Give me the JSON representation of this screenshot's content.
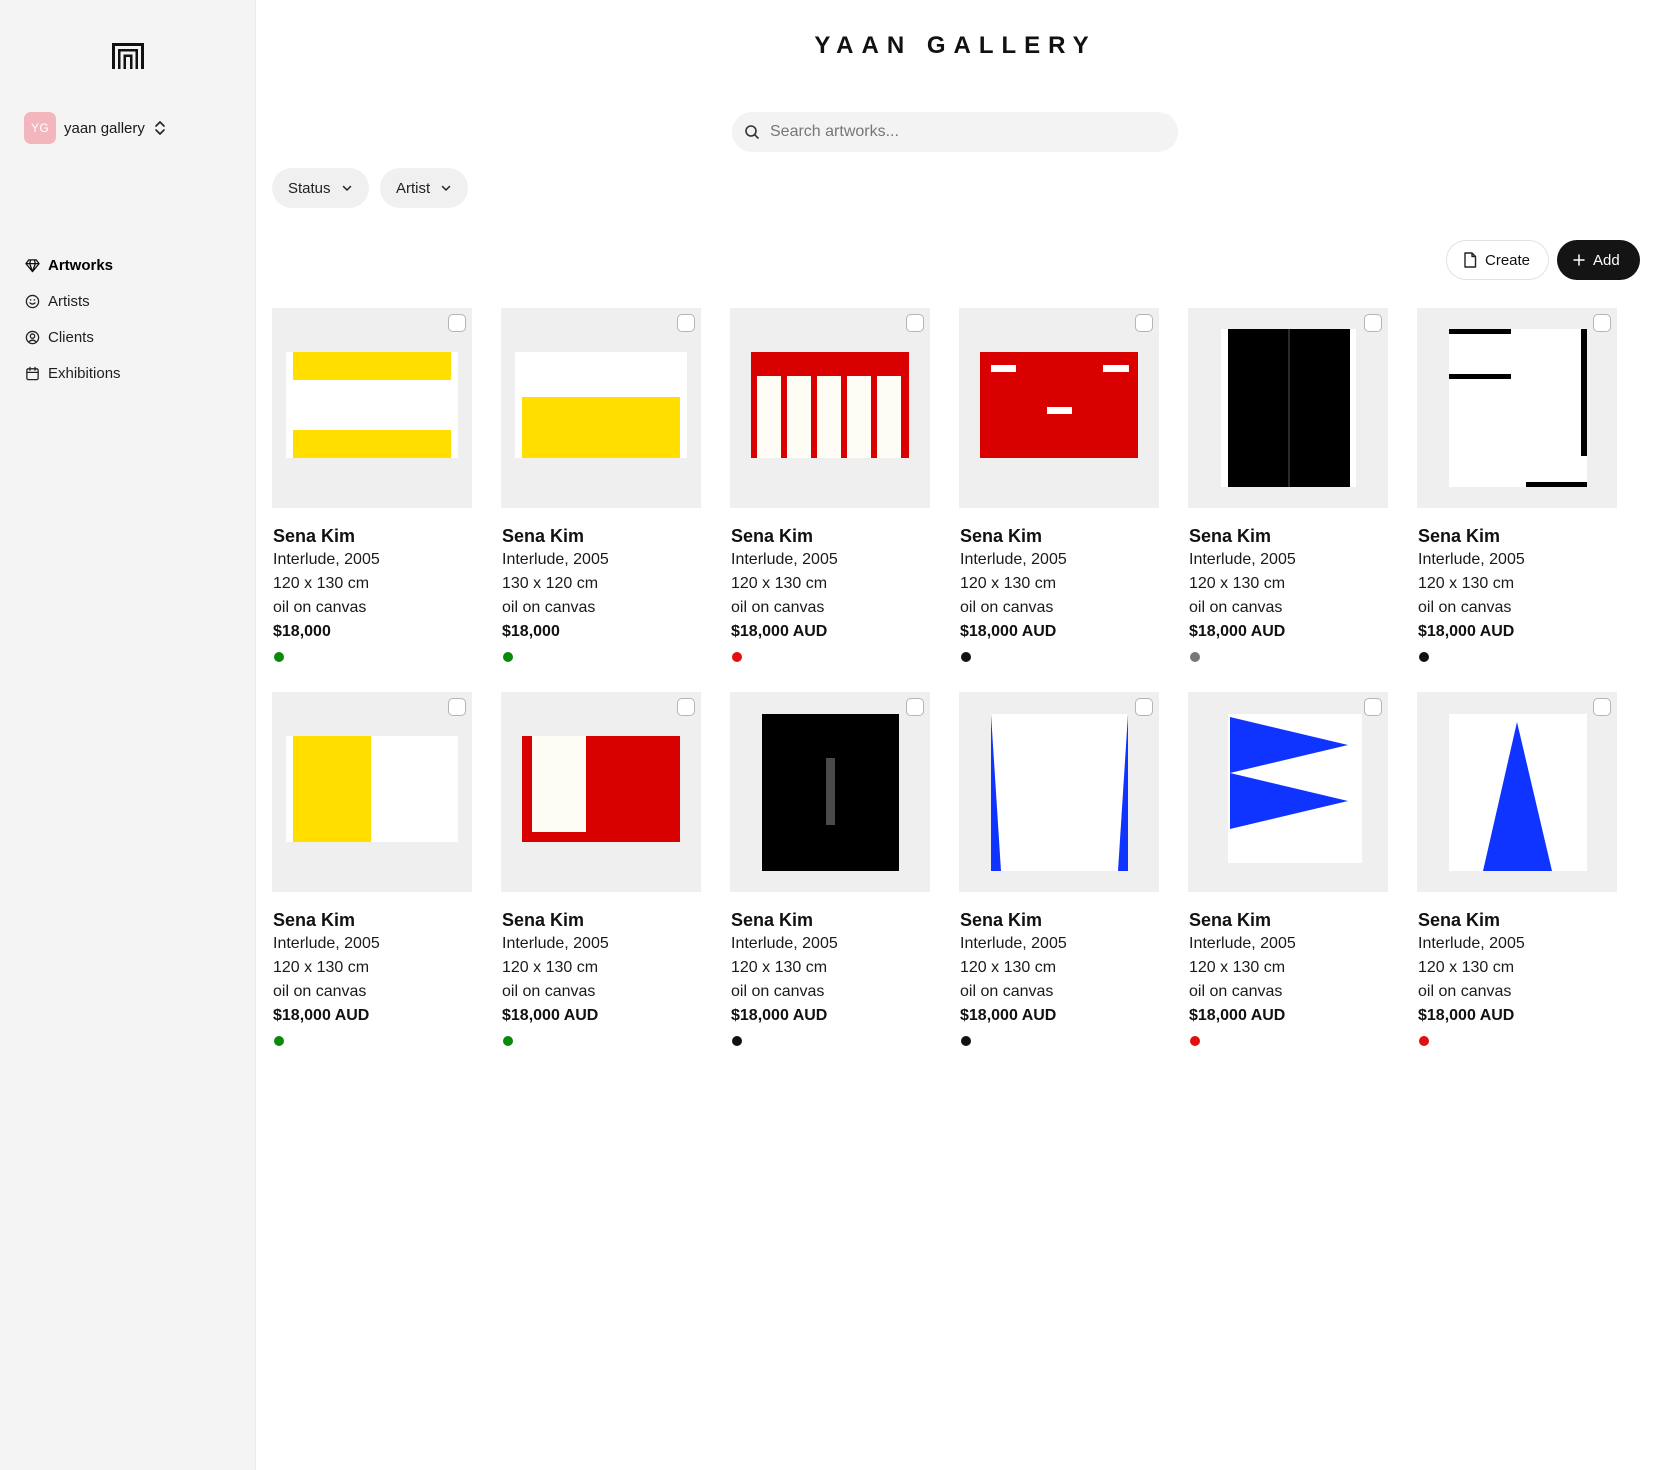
{
  "sidebar": {
    "org": {
      "initials": "YG",
      "name": "yaan gallery"
    },
    "nav": [
      {
        "label": "Artworks",
        "icon": "gem-icon",
        "active": true
      },
      {
        "label": "Artists",
        "icon": "smile-icon",
        "active": false
      },
      {
        "label": "Clients",
        "icon": "user-circle-icon",
        "active": false
      },
      {
        "label": "Exhibitions",
        "icon": "calendar-icon",
        "active": false
      }
    ]
  },
  "header": {
    "title": "YAAN GALLERY"
  },
  "search": {
    "placeholder": "Search artworks..."
  },
  "filters": [
    {
      "label": "Status"
    },
    {
      "label": "Artist"
    }
  ],
  "actions": {
    "create_label": "Create",
    "add_label": "Add"
  },
  "status_colors": {
    "green": "#0a8a0a",
    "red": "#e01010",
    "black": "#111111",
    "gray": "#777777"
  },
  "artworks": [
    {
      "artist": "Sena Kim",
      "title": "Interlude, 2005",
      "size": "120 x 130 cm",
      "medium": "oil on canvas",
      "price": "$18,000",
      "status": "green",
      "art": "yellow-stripes"
    },
    {
      "artist": "Sena Kim",
      "title": "Interlude, 2005",
      "size": "130 x 120 cm",
      "medium": "oil on canvas",
      "price": "$18,000",
      "status": "green",
      "art": "yellow-bottom"
    },
    {
      "artist": "Sena Kim",
      "title": "Interlude, 2005",
      "size": "120 x 130 cm",
      "medium": "oil on canvas",
      "price": "$18,000 AUD",
      "status": "red",
      "art": "red-bars"
    },
    {
      "artist": "Sena Kim",
      "title": "Interlude, 2005",
      "size": "120 x 130 cm",
      "medium": "oil on canvas",
      "price": "$18,000 AUD",
      "status": "black",
      "art": "red-dashes"
    },
    {
      "artist": "Sena Kim",
      "title": "Interlude, 2005",
      "size": "120 x 130 cm",
      "medium": "oil on canvas",
      "price": "$18,000 AUD",
      "status": "gray",
      "art": "black-diptych"
    },
    {
      "artist": "Sena Kim",
      "title": "Interlude, 2005",
      "size": "120 x 130 cm",
      "medium": "oil on canvas",
      "price": "$18,000 AUD",
      "status": "black",
      "art": "black-lines"
    },
    {
      "artist": "Sena Kim",
      "title": "Interlude, 2005",
      "size": "120 x 130 cm",
      "medium": "oil on canvas",
      "price": "$18,000 AUD",
      "status": "green",
      "art": "yellow-left"
    },
    {
      "artist": "Sena Kim",
      "title": "Interlude, 2005",
      "size": "120 x 130 cm",
      "medium": "oil on canvas",
      "price": "$18,000 AUD",
      "status": "green",
      "art": "red-white-block"
    },
    {
      "artist": "Sena Kim",
      "title": "Interlude, 2005",
      "size": "120 x 130 cm",
      "medium": "oil on canvas",
      "price": "$18,000 AUD",
      "status": "black",
      "art": "black-square"
    },
    {
      "artist": "Sena Kim",
      "title": "Interlude, 2005",
      "size": "120 x 130 cm",
      "medium": "oil on canvas",
      "price": "$18,000 AUD",
      "status": "black",
      "art": "blue-edges"
    },
    {
      "artist": "Sena Kim",
      "title": "Interlude, 2005",
      "size": "120 x 130 cm",
      "medium": "oil on canvas",
      "price": "$18,000 AUD",
      "status": "red",
      "art": "blue-flags"
    },
    {
      "artist": "Sena Kim",
      "title": "Interlude, 2005",
      "size": "120 x 130 cm",
      "medium": "oil on canvas",
      "price": "$18,000 AUD",
      "status": "red",
      "art": "blue-triangle"
    }
  ]
}
